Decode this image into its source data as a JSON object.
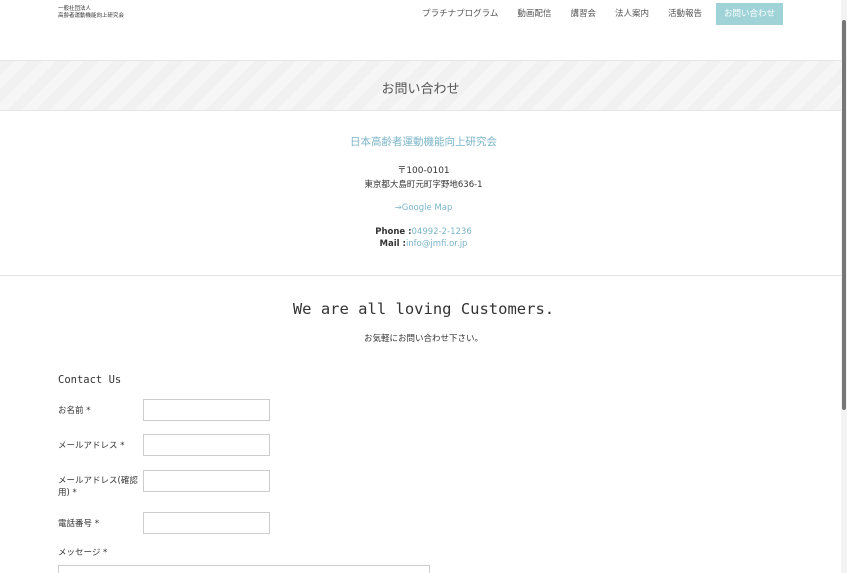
{
  "header": {
    "logo_line1": "一般社団法人",
    "logo_line2": "高齢者運動機能向上研究会",
    "nav": [
      {
        "label": "プラチナプログラム"
      },
      {
        "label": "動画配信"
      },
      {
        "label": "講習会"
      },
      {
        "label": "法人案内"
      },
      {
        "label": "活動報告"
      },
      {
        "label": "お問い合わせ"
      }
    ]
  },
  "page": {
    "title": "お問い合わせ"
  },
  "company": {
    "name": "日本高齢者運動機能向上研究会",
    "postal": "〒100-0101",
    "address": "東京都大島町元町字野地636-1",
    "map_link": "→Google Map",
    "phone_label": "Phone :",
    "phone": "04992-2-1236",
    "mail_label": "Mail :",
    "mail": "info@jmfi.or.jp"
  },
  "tagline": "We are all loving Customers.",
  "subtagline": "お気軽にお問い合わせ下さい。",
  "form": {
    "heading": "Contact Us",
    "name_label": "お名前 *",
    "email_label": "メールアドレス *",
    "email_confirm_label": "メールアドレス(確認用) *",
    "phone_label": "電話番号 *",
    "message_label": "メッセージ *"
  },
  "colors": {
    "accent": "#9fd3d8",
    "link": "#7bb5c9"
  }
}
